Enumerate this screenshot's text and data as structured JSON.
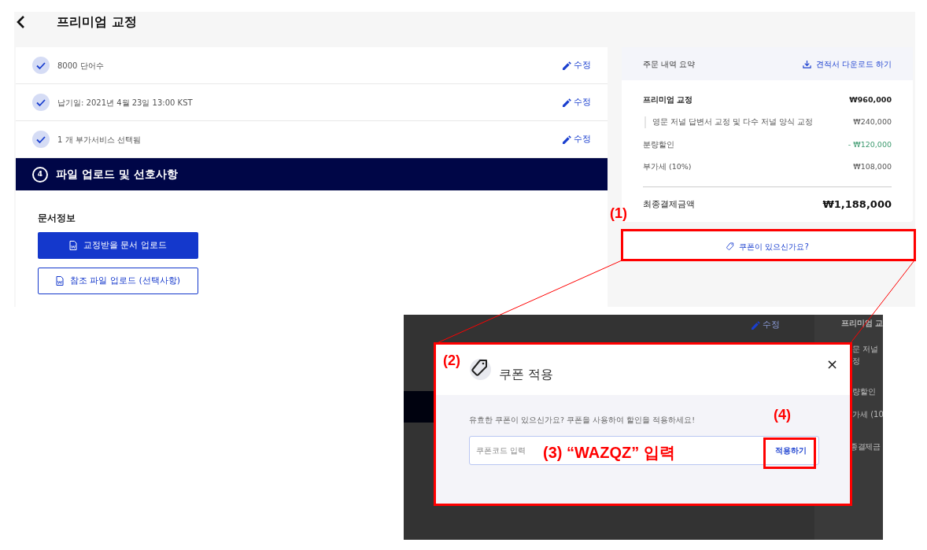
{
  "page": {
    "title": "프리미엄 교정"
  },
  "steps": [
    {
      "label": "8000 단어수",
      "checked": true,
      "action": "수정"
    },
    {
      "label": "납기일: 2021년 4월 23일 13:00 KST",
      "checked": true,
      "action": "수정"
    },
    {
      "label": "1 개 부가서비스 선택됨",
      "checked": true,
      "action": "수정"
    }
  ],
  "section": {
    "number": "4",
    "title": "파일 업로드 및 선호사항",
    "subtitle": "문서정보",
    "primary_button": "교정받을 문서 업로드",
    "secondary_button": "참조 파일 업로드 (선택사항)"
  },
  "summary": {
    "title": "주문 내역 요약",
    "download": "견적서 다운로드 하기",
    "lines": [
      {
        "kind": "main",
        "label": "프리미엄 교정",
        "amount": "₩960,000"
      },
      {
        "kind": "sub",
        "label": "영문 저널 답변서 교정 및 다수 저널 양식 교정",
        "amount": "₩240,000"
      },
      {
        "kind": "discount",
        "label": "분량할인",
        "amount": "- ₩120,000"
      },
      {
        "kind": "plain",
        "label": "부가세 (10%)",
        "amount": "₩108,000"
      }
    ],
    "total_label": "최종결제금액",
    "total": "₩1,188,000",
    "coupon_button": "쿠폰이 있으신가요?"
  },
  "inset": {
    "background_top": [
      "수정",
      "프리미엄 교"
    ],
    "background_side": [
      "문 저널",
      "정",
      "량할인",
      "가세 (10",
      "종결제금"
    ],
    "dialog": {
      "title": "쿠폰 적용",
      "message": "유효한 쿠폰이 있으신가요? 쿠폰을 사용하여 할인을 적용하세요!",
      "placeholder": "쿠폰코드 입력",
      "apply": "적용하기",
      "close": "×"
    }
  },
  "annotations": {
    "step1": "(1)",
    "step2": "(2)",
    "step3": "(3) “WAZQZ” 입력",
    "step4": "(4)"
  }
}
